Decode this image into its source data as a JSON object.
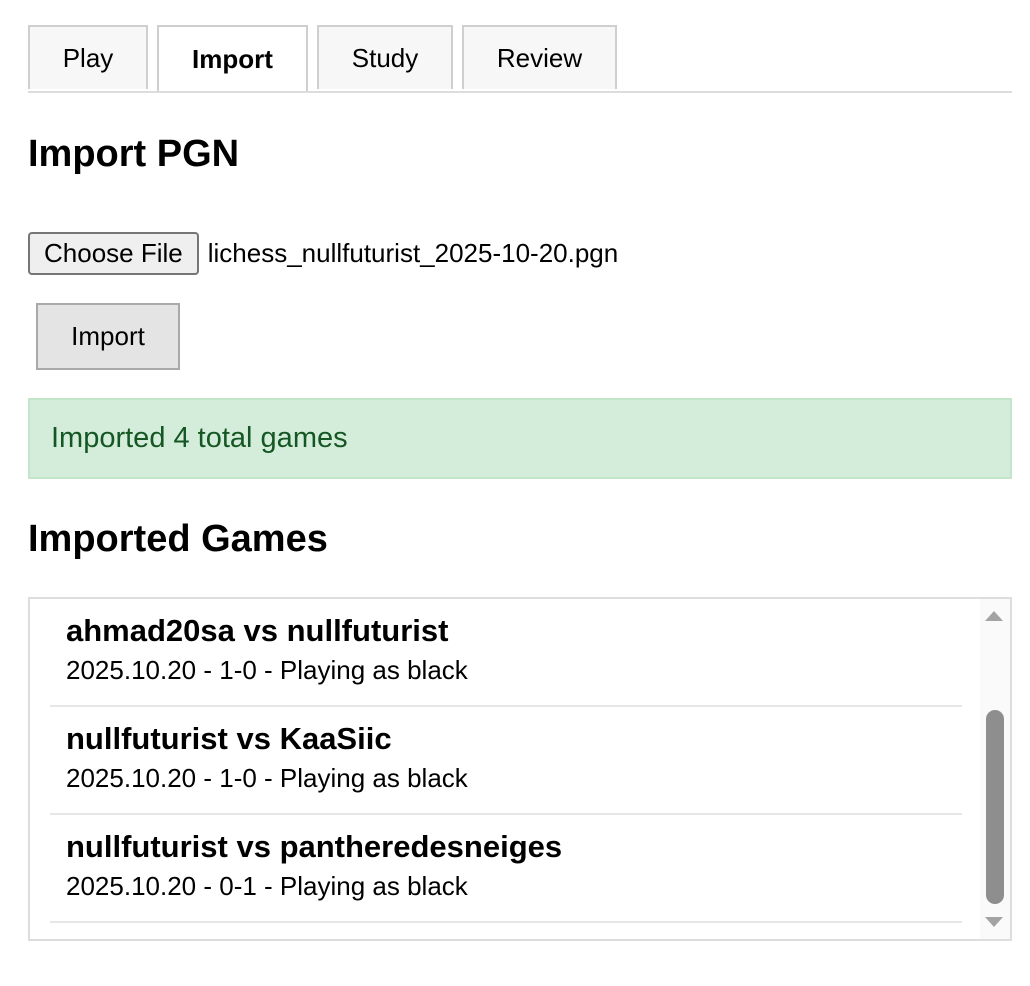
{
  "tabs": [
    {
      "label": "Play",
      "active": false
    },
    {
      "label": "Import",
      "active": true
    },
    {
      "label": "Study",
      "active": false
    },
    {
      "label": "Review",
      "active": false
    }
  ],
  "import_section": {
    "title": "Import PGN",
    "choose_file_label": "Choose File",
    "file_name": "lichess_nullfuturist_2025-10-20.pgn",
    "import_button_label": "Import"
  },
  "status": {
    "message": "Imported 4 total games",
    "background_color": "#d4edda",
    "text_color": "#155724"
  },
  "games_section": {
    "title": "Imported Games",
    "games": [
      {
        "title": "ahmad20sa vs nullfuturist",
        "meta": "2025.10.20 - 1-0 - Playing as black"
      },
      {
        "title": "nullfuturist vs KaaSiic",
        "meta": "2025.10.20 - 1-0 - Playing as black"
      },
      {
        "title": "nullfuturist vs pantheredesneiges",
        "meta": "2025.10.20 - 0-1 - Playing as black"
      }
    ]
  }
}
